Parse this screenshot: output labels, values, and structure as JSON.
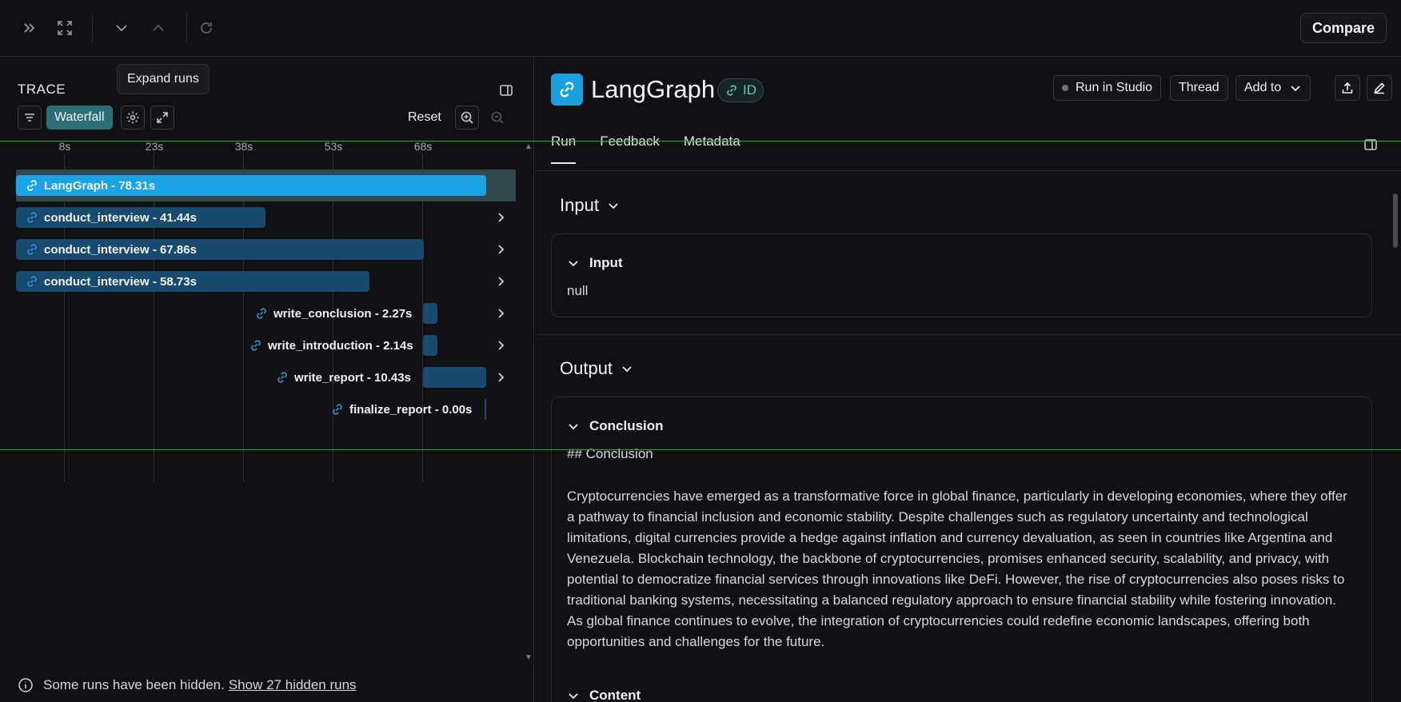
{
  "toolbar": {
    "compare_label": "Compare"
  },
  "trace": {
    "title": "TRACE",
    "tooltip": "Expand runs",
    "waterfall_label": "Waterfall",
    "reset_label": "Reset",
    "axis_ticks": [
      "8s",
      "23s",
      "38s",
      "53s",
      "68s"
    ],
    "runs": [
      {
        "label": "LangGraph - 78.31s",
        "duration_s": 78.31
      },
      {
        "label": "conduct_interview - 41.44s",
        "duration_s": 41.44
      },
      {
        "label": "conduct_interview - 67.86s",
        "duration_s": 67.86
      },
      {
        "label": "conduct_interview - 58.73s",
        "duration_s": 58.73
      },
      {
        "label": "write_conclusion - 2.27s",
        "duration_s": 2.27
      },
      {
        "label": "write_introduction - 2.14s",
        "duration_s": 2.14
      },
      {
        "label": "write_report - 10.43s",
        "duration_s": 10.43
      },
      {
        "label": "finalize_report - 0.00s",
        "duration_s": 0.0
      }
    ],
    "hidden_notice": "Some runs have been hidden.",
    "hidden_link": "Show 27 hidden runs"
  },
  "run": {
    "title": "LangGraph",
    "id_badge": "ID",
    "buttons": {
      "run_in_studio": "Run in Studio",
      "thread": "Thread",
      "add_to": "Add to"
    },
    "tabs": [
      "Run",
      "Feedback",
      "Metadata"
    ],
    "input": {
      "section_title": "Input",
      "sub_title": "Input",
      "value": "null"
    },
    "output": {
      "section_title": "Output",
      "conclusion_title": "Conclusion",
      "conclusion_heading": "## Conclusion",
      "conclusion_text": "Cryptocurrencies have emerged as a transformative force in global finance, particularly in developing economies, where they offer a pathway to financial inclusion and economic stability. Despite challenges such as regulatory uncertainty and technological limitations, digital currencies provide a hedge against inflation and currency devaluation, as seen in countries like Argentina and Venezuela. Blockchain technology, the backbone of cryptocurrencies, promises enhanced security, scalability, and privacy, with potential to democratize financial services through innovations like DeFi. However, the rise of cryptocurrencies also poses risks to traditional banking systems, necessitating a balanced regulatory approach to ensure financial stability while fostering innovation. As global finance continues to evolve, the integration of cryptocurrencies could redefine economic landscapes, offering both opportunities and challenges for the future.",
      "content_title": "Content"
    }
  },
  "colors": {
    "root_bar": "#1aa3e6",
    "child_bar": "#174a6c",
    "accent_teal": "#2d6f76"
  }
}
